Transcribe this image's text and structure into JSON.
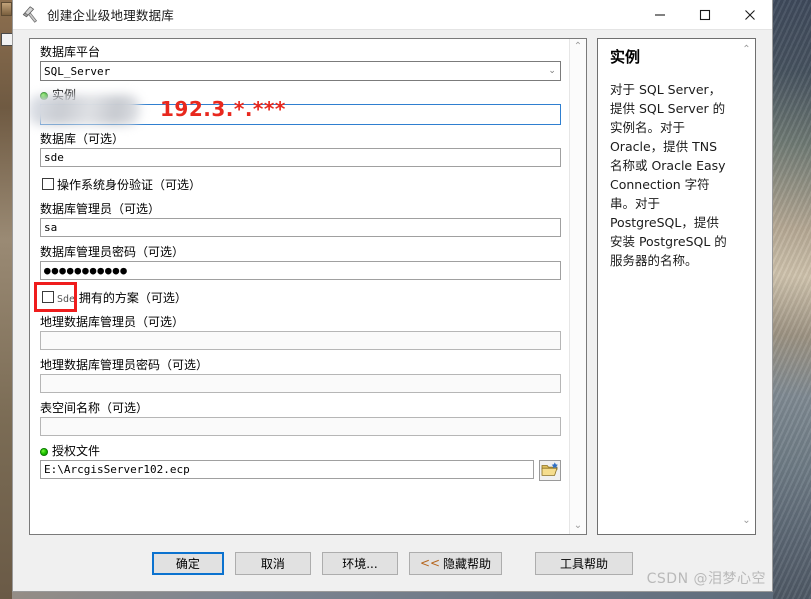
{
  "window": {
    "title": "创建企业级地理数据库",
    "icon": "hammer-icon",
    "minimize": "—",
    "maximize": "▢",
    "close": "✕"
  },
  "form": {
    "platform": {
      "label": "数据库平台",
      "value": "SQL_Server",
      "chevron": "⌄"
    },
    "instance": {
      "label": "实例",
      "value": "",
      "annotation": "192.3.*.***",
      "annotation_color": "#e8281e",
      "required": true
    },
    "database": {
      "label": "数据库（可选）",
      "value": "sde"
    },
    "os_auth": {
      "label": "操作系统身份验证（可选）",
      "checked": false
    },
    "db_admin": {
      "label": "数据库管理员（可选）",
      "value": "sa"
    },
    "db_admin_password": {
      "label": "数据库管理员密码（可选）",
      "value": "●●●●●●●●●●●"
    },
    "sde_schema": {
      "label_prefix": "Sde",
      "label_suffix": "拥有的方案（可选）",
      "checked": false,
      "highlighted": true,
      "highlight_color": "#ef1c1c"
    },
    "gdb_admin": {
      "label": "地理数据库管理员（可选）",
      "value": ""
    },
    "gdb_admin_password": {
      "label": "地理数据库管理员密码（可选）",
      "value": ""
    },
    "tablespace": {
      "label": "表空间名称（可选）",
      "value": ""
    },
    "license_file": {
      "label": "授权文件",
      "value": "E:\\ArcgisServer102.ecp",
      "required": true,
      "browse_icon": "open-folder-icon"
    },
    "scroll_up": "⌃",
    "scroll_down": "⌄"
  },
  "help": {
    "title": "实例",
    "body": "对于 SQL Server，提供 SQL Server 的实例名。对于 Oracle，提供 TNS 名称或 Oracle Easy Connection 字符串。对于 PostgreSQL，提供安装 PostgreSQL 的服务器的名称。",
    "scroll_up": "⌃",
    "scroll_down": "⌄"
  },
  "footer": {
    "ok": "确定",
    "cancel": "取消",
    "environments": "环境...",
    "hide_help_arrows": "<<",
    "hide_help": "隐藏帮助",
    "tool_help": "工具帮助"
  },
  "watermark": "CSDN @泪梦心空"
}
